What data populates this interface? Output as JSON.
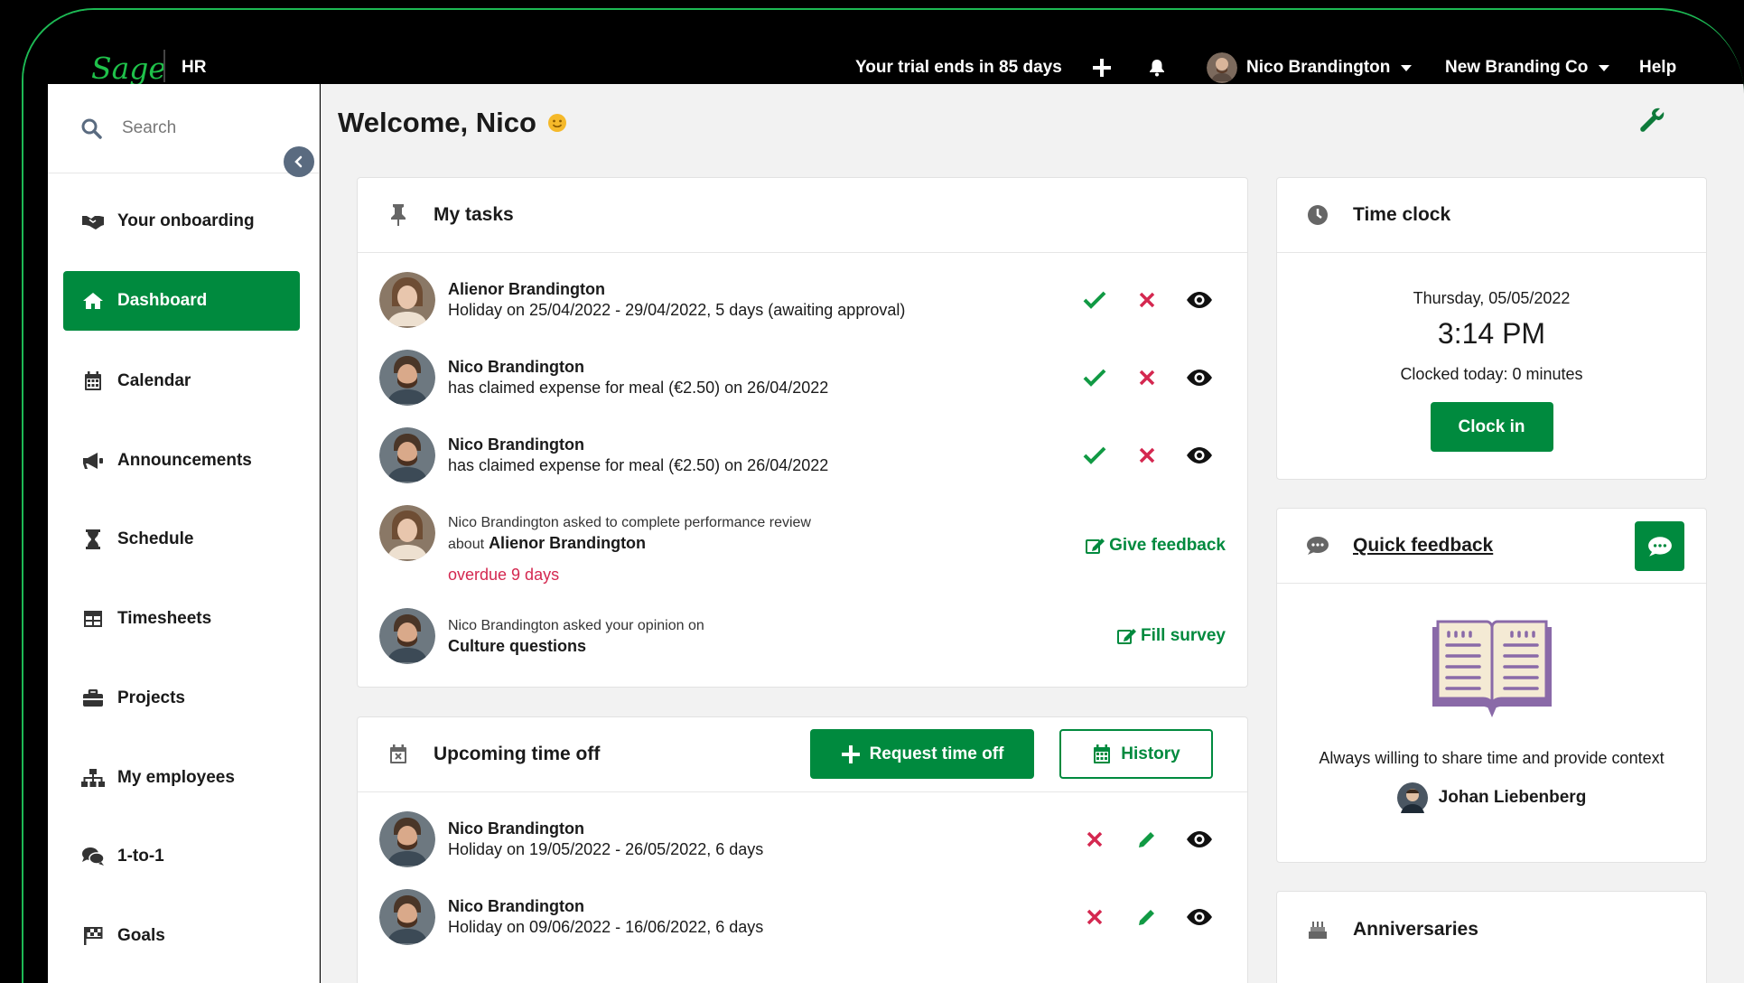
{
  "topbar": {
    "logo": "Sage",
    "app": "HR",
    "trial": "Your trial ends in 85 days",
    "user": "Nico Brandington",
    "company": "New Branding Co",
    "help": "Help"
  },
  "search": {
    "placeholder": "Search"
  },
  "sidebar": {
    "items": [
      {
        "label": "Your onboarding",
        "icon": "handshake-icon"
      },
      {
        "label": "Dashboard",
        "icon": "home-icon"
      },
      {
        "label": "Calendar",
        "icon": "calendar-icon"
      },
      {
        "label": "Announcements",
        "icon": "megaphone-icon"
      },
      {
        "label": "Schedule",
        "icon": "hourglass-icon"
      },
      {
        "label": "Timesheets",
        "icon": "table-icon"
      },
      {
        "label": "Projects",
        "icon": "briefcase-icon"
      },
      {
        "label": "My employees",
        "icon": "org-chart-icon"
      },
      {
        "label": "1-to-1",
        "icon": "chat-icon"
      },
      {
        "label": "Goals",
        "icon": "flag-icon"
      }
    ]
  },
  "welcome": "Welcome, Nico",
  "tasks": {
    "title": "My tasks",
    "items": [
      {
        "name": "Alienor Brandington",
        "detail": "Holiday on 25/04/2022 - 29/04/2022, 5 days (awaiting approval)"
      },
      {
        "name": "Nico Brandington",
        "detail": "has claimed expense for meal (€2.50) on 26/04/2022"
      },
      {
        "name": "Nico Brandington",
        "detail": "has claimed expense for meal (€2.50) on 26/04/2022"
      }
    ],
    "review": {
      "line1": "Nico Brandington asked to complete performance review",
      "line2_prefix": "about",
      "line2_name": "Alienor Brandington",
      "overdue": "overdue 9 days",
      "action": "Give feedback"
    },
    "survey": {
      "line1": "Nico Brandington asked your opinion on",
      "line2": "Culture questions",
      "action": "Fill survey"
    }
  },
  "timeoff": {
    "title": "Upcoming time off",
    "request_label": "Request time off",
    "history_label": "History",
    "items": [
      {
        "name": "Nico Brandington",
        "detail": "Holiday on 19/05/2022 - 26/05/2022, 6 days"
      },
      {
        "name": "Nico Brandington",
        "detail": "Holiday on 09/06/2022 - 16/06/2022, 6 days"
      }
    ]
  },
  "timeclock": {
    "title": "Time clock",
    "date": "Thursday, 05/05/2022",
    "time": "3:14 PM",
    "clocked": "Clocked today: 0 minutes",
    "button": "Clock in"
  },
  "feedback": {
    "title": "Quick feedback",
    "quote": "Always willing to share time and provide context",
    "person": "Johan Liebenberg"
  },
  "anniversaries": {
    "title": "Anniversaries"
  },
  "colors": {
    "brand": "#008a3e",
    "logo": "#1fc14a",
    "danger": "#d42850"
  }
}
